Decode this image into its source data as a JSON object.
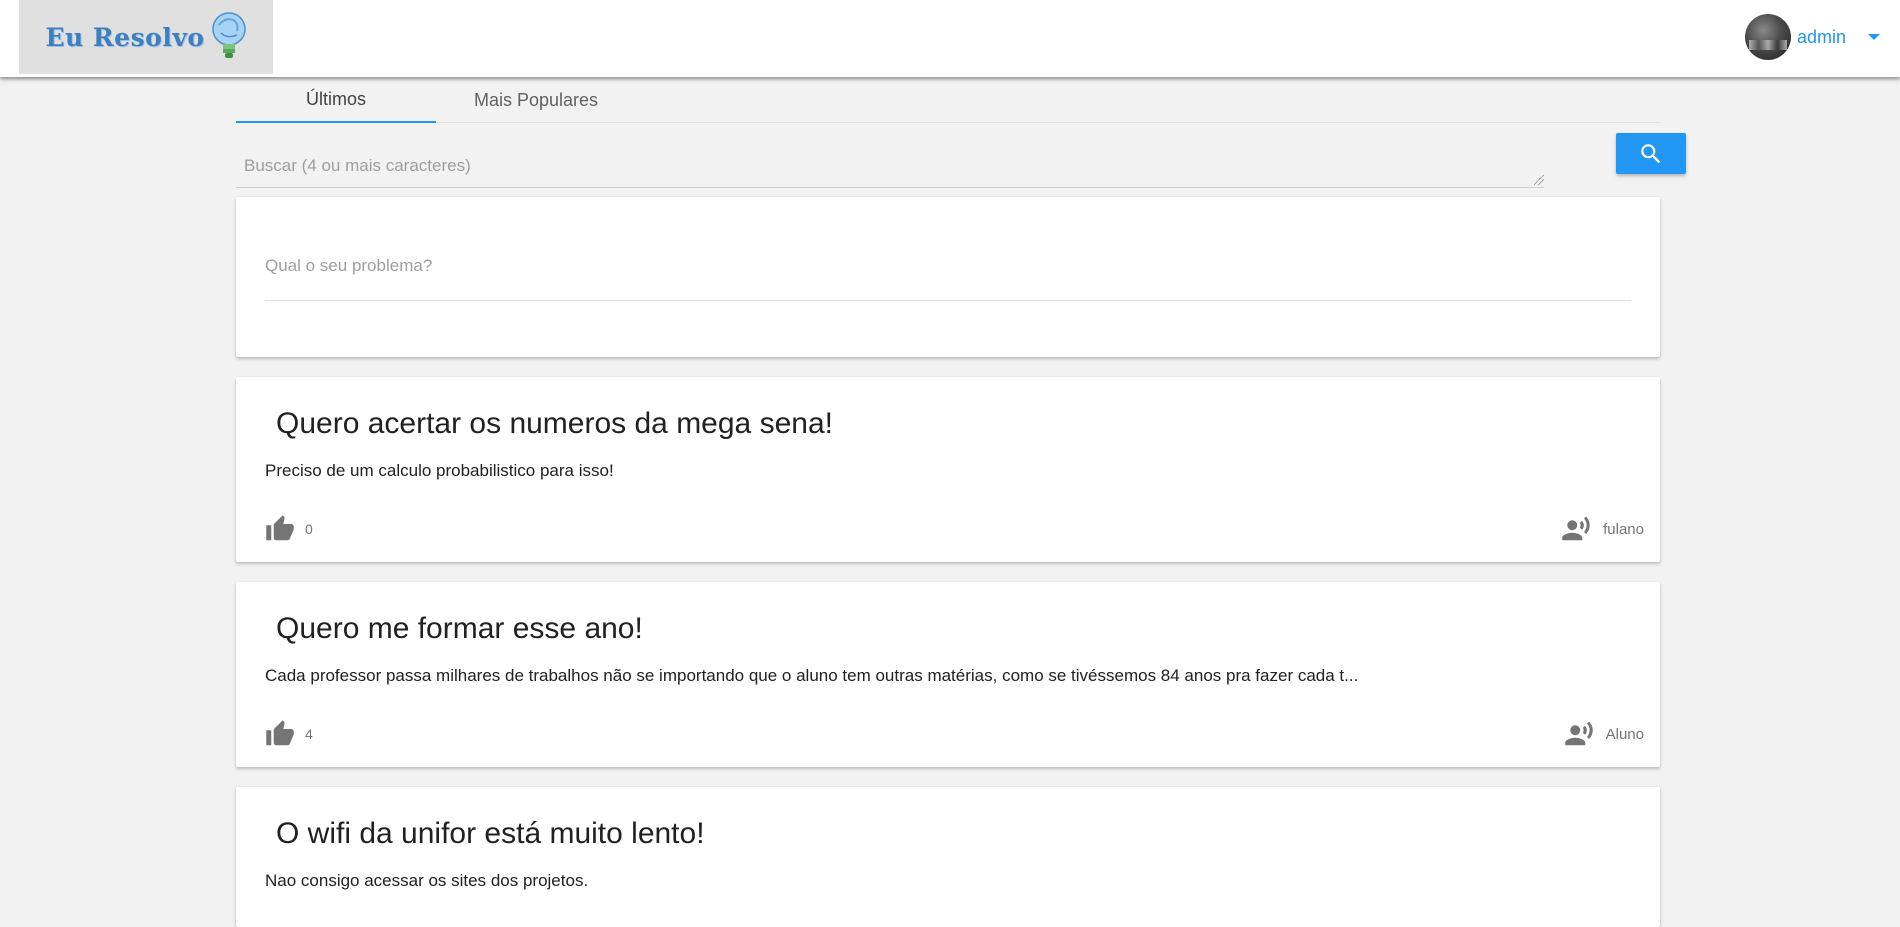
{
  "header": {
    "logo_text": "Eu Resolvo",
    "user_name": "admin"
  },
  "tabs": [
    {
      "label": "Últimos",
      "active": true
    },
    {
      "label": "Mais Populares",
      "active": false
    }
  ],
  "search": {
    "placeholder": "Buscar (4 ou mais caracteres)",
    "value": ""
  },
  "new_problem": {
    "placeholder": "Qual o seu problema?"
  },
  "posts": [
    {
      "title": "Quero acertar os numeros da mega sena!",
      "body": "Preciso de um calculo probabilistico para isso!",
      "likes": "0",
      "author": "fulano"
    },
    {
      "title": "Quero me formar esse ano!",
      "body": "Cada professor passa milhares de trabalhos não se importando que o aluno tem outras matérias, como se tivéssemos 84 anos pra fazer cada t...",
      "likes": "4",
      "author": "Aluno"
    },
    {
      "title": "O wifi da unifor está muito lento!",
      "body": "Nao consigo acessar os sites dos projetos."
    }
  ],
  "colors": {
    "accent": "#2196f3",
    "background": "#f2f2f2",
    "icon_gray": "#757575"
  },
  "icons": {
    "search": "search-icon",
    "like": "thumb-up-icon",
    "author": "record-voice-icon",
    "logo": "lightbulb-icon",
    "user_menu": "caret-down-icon"
  }
}
